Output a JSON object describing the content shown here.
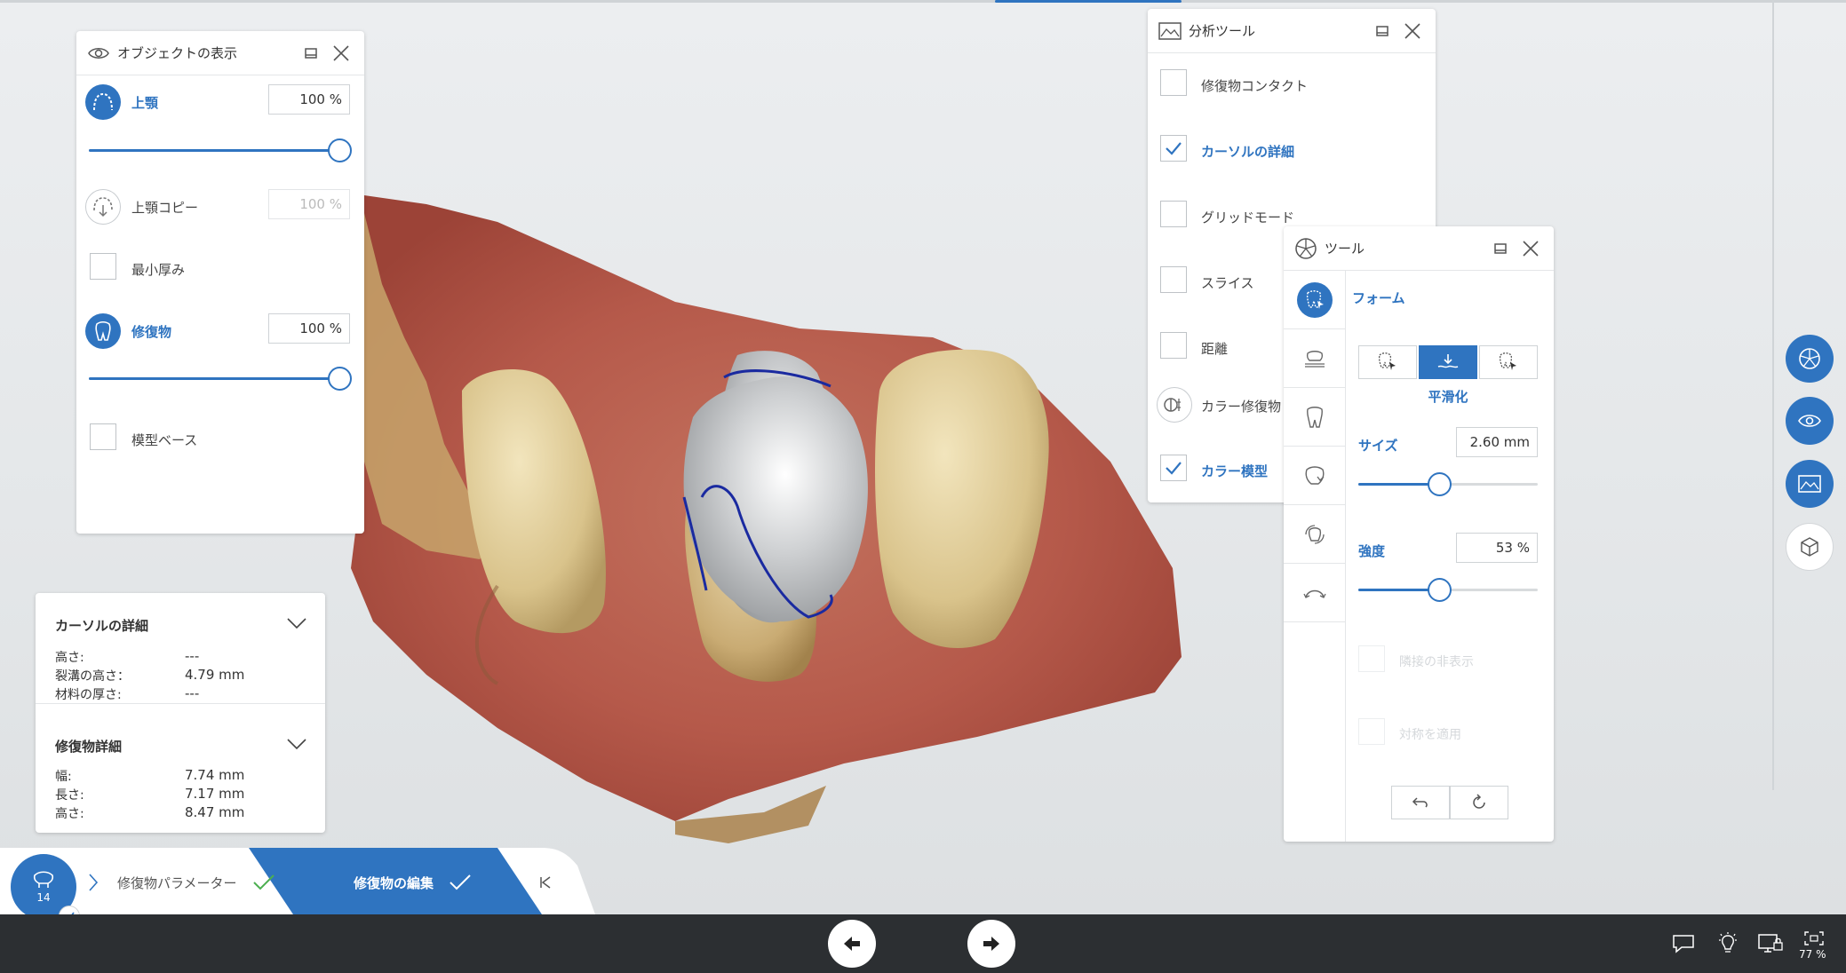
{
  "colors": {
    "accent": "#2f74c0",
    "success": "#4caf50",
    "bottom_bar": "#2c2f32"
  },
  "object_panel": {
    "title": "オブジェクトの表示",
    "upper_jaw": {
      "label": "上顎",
      "value": "100 %",
      "level_pct": 100
    },
    "upper_jaw_copy": {
      "label": "上顎コピー",
      "value": "100 %"
    },
    "min_thickness": {
      "label": "最小厚み",
      "checked": false
    },
    "restoration": {
      "label": "修復物",
      "value": "100 %",
      "level_pct": 100
    },
    "model_base": {
      "label": "模型ベース",
      "checked": false
    }
  },
  "analysis_panel": {
    "title": "分析ツール",
    "items": [
      {
        "label": "修復物コンタクト",
        "checked": false
      },
      {
        "label": "カーソルの詳細",
        "checked": true
      },
      {
        "label": "グリッドモード",
        "checked": false
      },
      {
        "label": "スライス",
        "checked": false
      },
      {
        "label": "距離",
        "checked": false
      },
      {
        "label": "カラー修復物"
      },
      {
        "label": "カラー模型",
        "checked": true
      }
    ]
  },
  "tool_panel": {
    "title": "ツール",
    "form_label": "フォーム",
    "mode_label": "平滑化",
    "size_label": "サイズ",
    "size_value": "2.60 mm",
    "size_level_pct": 45,
    "strength_label": "強度",
    "strength_value": "53 %",
    "strength_level_pct": 45,
    "hide_adjacent_label": "隣接の非表示",
    "apply_symmetry_label": "対称を適用"
  },
  "info_panel": {
    "cursor_title": "カーソルの詳細",
    "cursor_rows": [
      {
        "key": "高さ:",
        "value": "---"
      },
      {
        "key": "裂溝の高さ：",
        "value": "4.79 mm"
      },
      {
        "key": "材料の厚さ:",
        "value": "---"
      }
    ],
    "restoration_title": "修復物詳細",
    "restoration_rows": [
      {
        "key": "幅:",
        "value": "7.74 mm"
      },
      {
        "key": "長さ:",
        "value": "7.17 mm"
      },
      {
        "key": "高さ:",
        "value": "8.47 mm"
      }
    ]
  },
  "workflow": {
    "tooth_number": "14",
    "step1_label": "修復物パラメーター",
    "step2_label": "修復物の編集"
  },
  "status": {
    "zoom": "77 %"
  }
}
